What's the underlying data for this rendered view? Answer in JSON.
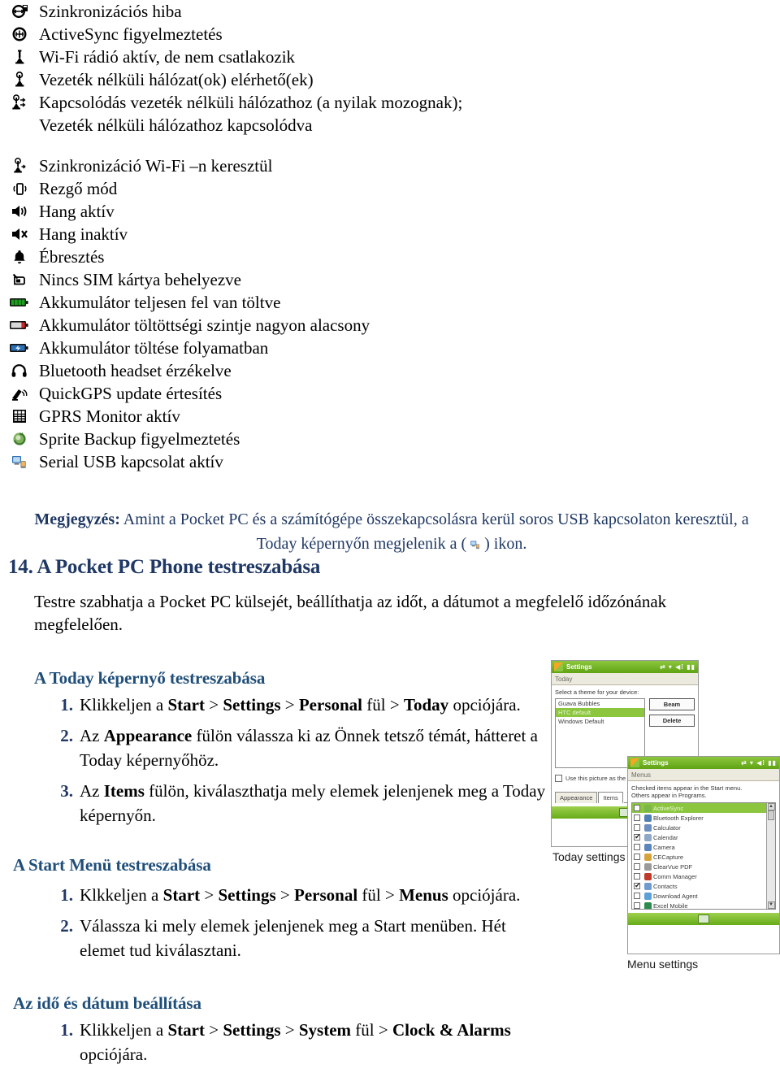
{
  "status_icons": {
    "group1": [
      {
        "icon": "sync-error-icon",
        "label": "Szinkronizációs hiba"
      },
      {
        "icon": "activesync-alert-icon",
        "label": "ActiveSync figyelmeztetés"
      },
      {
        "icon": "wifi-radio-on-icon",
        "label": "Wi-Fi rádió aktív, de nem csatlakozik"
      },
      {
        "icon": "wifi-available-icon",
        "label": "Vezeték nélküli hálózat(ok) elérhető(ek)"
      },
      {
        "icon": "wifi-connecting-icon",
        "label": "Kapcsolódás vezeték nélküli hálózathoz (a nyilak mozognak);"
      },
      {
        "icon": "blank-icon",
        "label": "Vezeték nélküli hálózathoz kapcsolódva"
      }
    ],
    "group2": [
      {
        "icon": "sync-wifi-icon",
        "label": "Szinkronizáció Wi-Fi –n keresztül"
      },
      {
        "icon": "vibrate-icon",
        "label": "Rezgő mód"
      },
      {
        "icon": "sound-on-icon",
        "label": "Hang aktív"
      },
      {
        "icon": "sound-off-icon",
        "label": "Hang inaktív"
      },
      {
        "icon": "alarm-bell-icon",
        "label": "Ébresztés"
      },
      {
        "icon": "no-sim-icon",
        "label": "Nincs SIM kártya behelyezve"
      },
      {
        "icon": "battery-full-icon",
        "label": "Akkumulátor teljesen fel van töltve"
      },
      {
        "icon": "battery-low-icon",
        "label": "Akkumulátor töltöttségi szintje nagyon alacsony"
      },
      {
        "icon": "battery-charging-icon",
        "label": "Akkumulátor töltése folyamatban"
      },
      {
        "icon": "bluetooth-headset-icon",
        "label": "Bluetooth headset érzékelve"
      },
      {
        "icon": "quickgps-icon",
        "label": "QuickGPS update értesítés"
      },
      {
        "icon": "gprs-monitor-icon",
        "label": "GPRS Monitor aktív"
      },
      {
        "icon": "sprite-backup-icon",
        "label": "Sprite Backup figyelmeztetés"
      },
      {
        "icon": "serial-usb-icon",
        "label": "Serial USB kapcsolat aktív"
      }
    ]
  },
  "note": {
    "label": "Megjegyzés:",
    "text_before_icon": " Amint a Pocket PC és a számítógépe összekapcsolásra kerül soros USB kapcsolaton keresztül, a Today képernyőn megjelenik a (",
    "icon": "serial-usb-icon",
    "text_after_icon": ") ikon."
  },
  "section": {
    "number": "14.",
    "title": "A Pocket PC Phone testreszabása",
    "full_title": "14. A Pocket PC Phone testreszabása",
    "intro": "Testre szabhatja a Pocket PC külsejét, beállíthatja az időt, a dátumot a megfelelő időzónának megfelelően."
  },
  "subsections": [
    {
      "title": "A Today képernyő testreszabása",
      "steps": [
        {
          "num": "1.",
          "html": "Klikkeljen a <b>Start</b> &gt; <b>Settings</b> &gt; <b>Personal</b> fül &gt; <b>Today</b> opciójára."
        },
        {
          "num": "2.",
          "html": "Az <b>Appearance</b> fülön válassza ki az Önnek tetsző témát, hátteret a Today képernyőhöz."
        },
        {
          "num": "3.",
          "html": "Az <b>Items</b> fülön, kiválaszthatja mely elemek jelenjenek meg a Today képernyőn."
        }
      ]
    },
    {
      "title": "A Start Menü testreszabása",
      "steps": [
        {
          "num": "1.",
          "html": "Klkkeljen a <b>Start</b> &gt; <b>Settings</b> &gt; <b>Personal</b> fül &gt; <b>Menus</b> opciójára."
        },
        {
          "num": "2.",
          "html": "Válassza ki mely elemek jelenjenek meg a Start menüben. Hét elemet tud kiválasztani."
        }
      ]
    },
    {
      "title": "Az idő és dátum beállítása",
      "steps": [
        {
          "num": "1.",
          "html": "Klikkeljen a <b>Start</b> &gt; <b>Settings</b> &gt; <b>System</b> fül &gt; <b>Clock &amp; Alarms</b> opciójára."
        }
      ]
    }
  ],
  "screenshots": {
    "today": {
      "titlebar": "Settings",
      "titlebar_icons": "⇄ ▾ ◀⁞ ▮▮",
      "subbar": "Today",
      "prompt": "Select a theme for your device:",
      "themes": [
        {
          "label": "Guava Bubbles",
          "selected": false
        },
        {
          "label": "HTC default",
          "selected": true
        },
        {
          "label": "Windows Default",
          "selected": false
        }
      ],
      "buttons": [
        "Beam",
        "Delete"
      ],
      "checkbox_label": "Use this picture as the b",
      "tabs": [
        "Appearance",
        "Items"
      ],
      "caption": "Today settings"
    },
    "menu": {
      "titlebar": "Settings",
      "titlebar_icons": "⇄ ▾ ◀⁞ ▮▮",
      "subbar": "Menus",
      "prompt_line1": "Checked items appear in the Start menu.",
      "prompt_line2": "Others appear in Programs.",
      "items": [
        {
          "label": "ActiveSync",
          "checked": false,
          "selected": true,
          "color": "#7bb648"
        },
        {
          "label": "Bluetooth Explorer",
          "checked": false,
          "selected": false,
          "color": "#4f7fb5"
        },
        {
          "label": "Calculator",
          "checked": false,
          "selected": false,
          "color": "#6a8fc0"
        },
        {
          "label": "Calendar",
          "checked": true,
          "selected": false,
          "color": "#8fa8c9"
        },
        {
          "label": "Camera",
          "checked": false,
          "selected": false,
          "color": "#5a86bd"
        },
        {
          "label": "CECapture",
          "checked": false,
          "selected": false,
          "color": "#d6a33a"
        },
        {
          "label": "ClearVue PDF",
          "checked": false,
          "selected": false,
          "color": "#9a9a9a"
        },
        {
          "label": "Comm Manager",
          "checked": false,
          "selected": false,
          "color": "#c0392b"
        },
        {
          "label": "Contacts",
          "checked": true,
          "selected": false,
          "color": "#6f9bd1"
        },
        {
          "label": "Download Agent",
          "checked": false,
          "selected": false,
          "color": "#5da0d8"
        },
        {
          "label": "Excel Mobile",
          "checked": false,
          "selected": false,
          "color": "#2d8a4e"
        }
      ],
      "caption": "Menu settings"
    }
  },
  "colors": {
    "heading_navy": "#1F3864",
    "subheading_blue": "#1F4E79",
    "ppc_green": "#8cc63e",
    "battery_green": "#18a01c",
    "battery_red": "#d2232a"
  }
}
